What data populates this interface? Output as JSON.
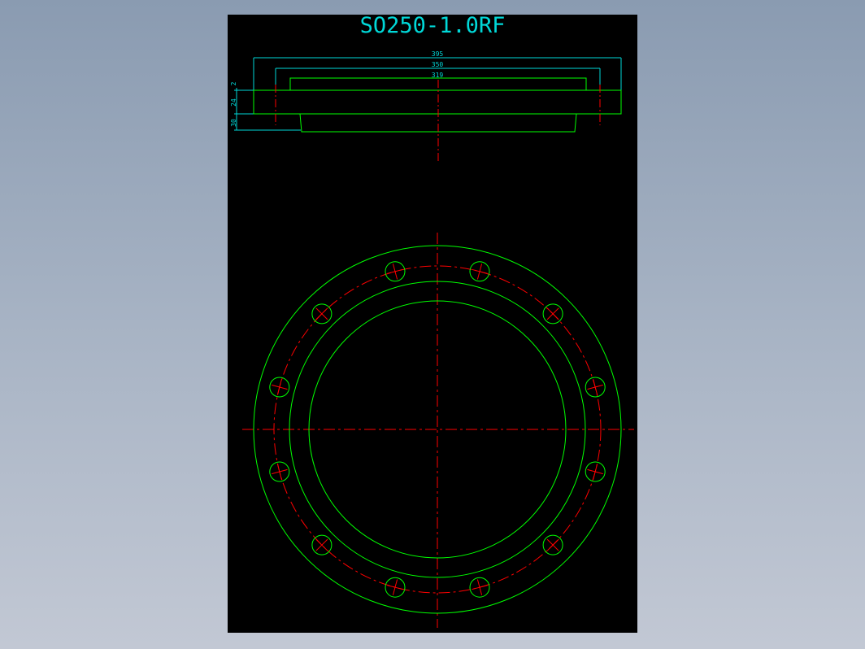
{
  "drawing": {
    "title": "SO250-1.0RF",
    "colors": {
      "background": "#000000",
      "outline": "#00ff00",
      "centerline": "#ff0000",
      "dimension": "#00d8d8"
    }
  },
  "dimensions": {
    "diameters": [
      "395",
      "350",
      "319"
    ],
    "thicknesses": [
      "2",
      "24",
      "30"
    ]
  },
  "flange": {
    "bolt_hole_count": 12
  }
}
